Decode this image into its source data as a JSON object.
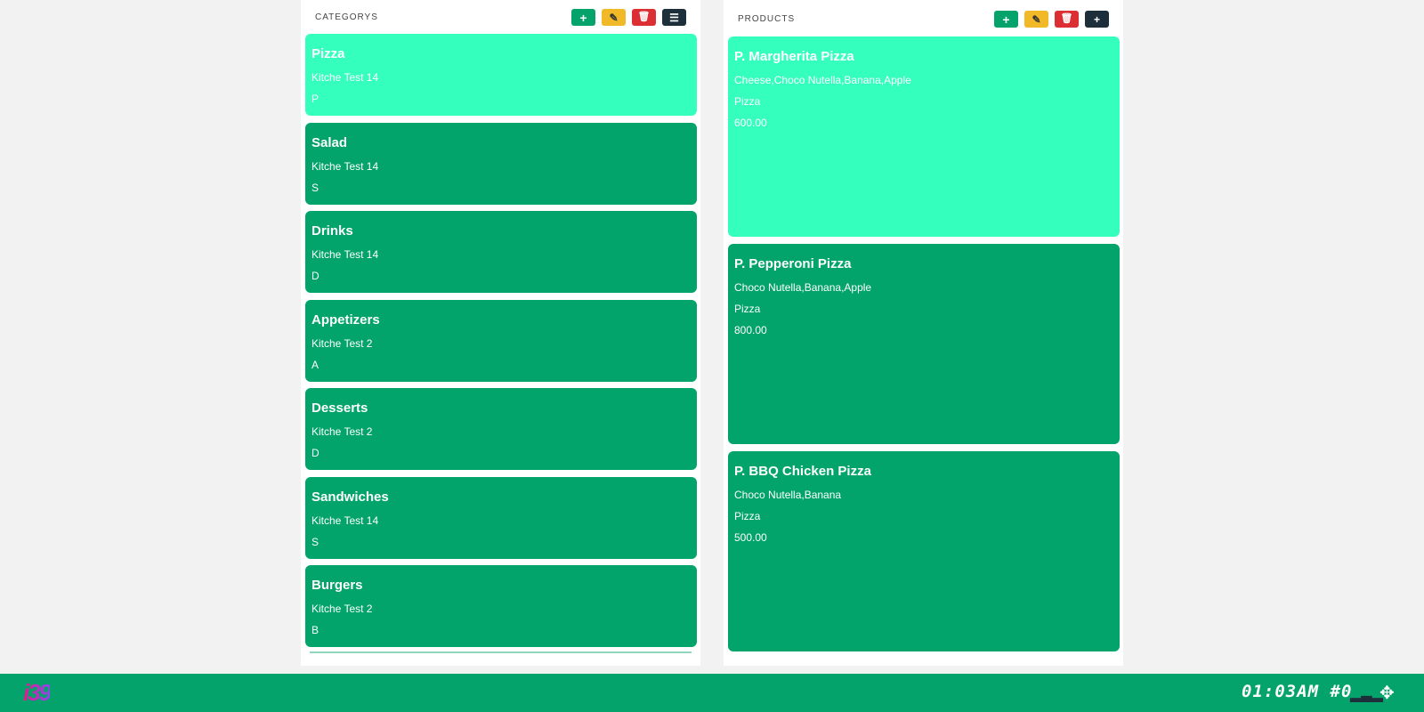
{
  "categories": {
    "title": "CATEGORYS",
    "buttons": {
      "add": "+",
      "edit": "✎",
      "delete": "🗑",
      "list": "☰"
    },
    "items": [
      {
        "name": "Pizza",
        "kitchen": "Kitche Test 14",
        "code": "P",
        "active": true
      },
      {
        "name": "Salad",
        "kitchen": "Kitche Test 14",
        "code": "S"
      },
      {
        "name": "Drinks",
        "kitchen": "Kitche Test 14",
        "code": "D"
      },
      {
        "name": "Appetizers",
        "kitchen": "Kitche Test 2",
        "code": "A"
      },
      {
        "name": "Desserts",
        "kitchen": "Kitche Test 2",
        "code": "D"
      },
      {
        "name": "Sandwiches",
        "kitchen": "Kitche Test 14",
        "code": "S"
      },
      {
        "name": "Burgers",
        "kitchen": "Kitche Test 2",
        "code": "B"
      }
    ]
  },
  "products": {
    "title": "PRODUCTS",
    "buttons": {
      "add": "+",
      "edit": "✎",
      "delete": "🗑",
      "more": "+"
    },
    "items": [
      {
        "name": "P. Margherita Pizza",
        "ingredients": "Cheese,Choco Nutella,Banana,Apple",
        "category": "Pizza",
        "price": "600.00",
        "active": true
      },
      {
        "name": "P. Pepperoni Pizza",
        "ingredients": "Choco Nutella,Banana,Apple",
        "category": "Pizza",
        "price": "800.00"
      },
      {
        "name": "P. BBQ Chicken Pizza",
        "ingredients": "Choco Nutella,Banana",
        "category": "Pizza",
        "price": "500.00"
      }
    ]
  },
  "footer": {
    "logo": "i39",
    "clock": "01:03AM #0",
    "colors": {
      "bar": "#03a36b",
      "active": "#35ffbd",
      "card": "#02a46c"
    }
  }
}
